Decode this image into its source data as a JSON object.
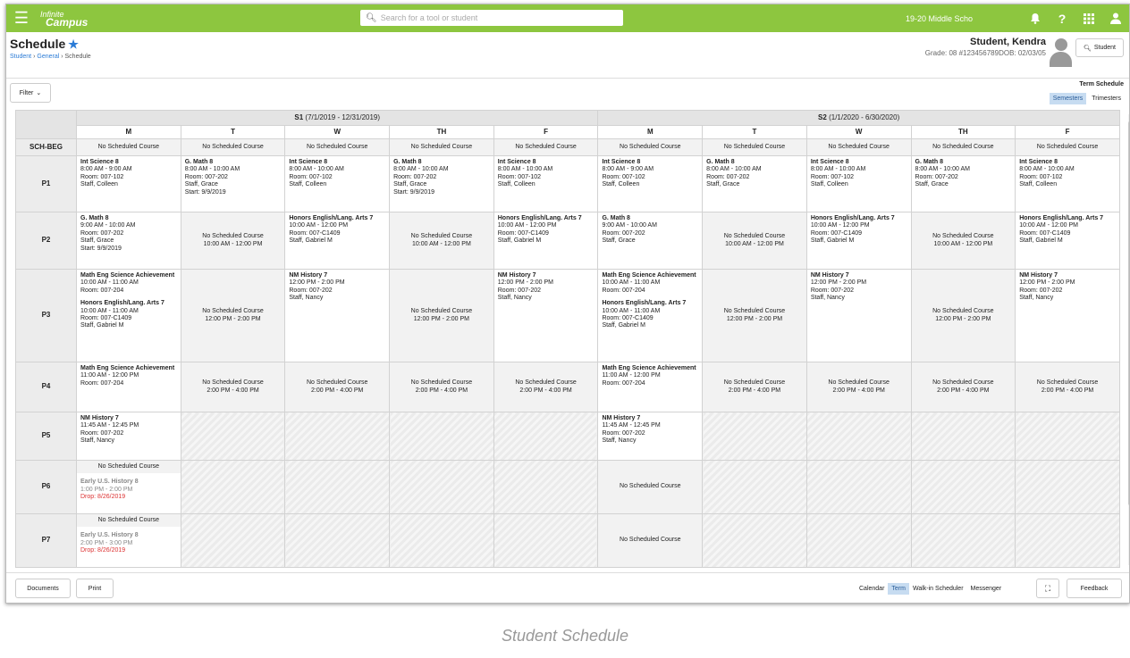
{
  "app": {
    "logo_line1": "Infinite",
    "logo_line2": "Campus",
    "search_placeholder": "Search for a tool or student",
    "school": "19-20 Middle Scho"
  },
  "header": {
    "title": "Schedule",
    "breadcrumb": [
      "Student",
      "General",
      "Schedule"
    ],
    "student_name": "Student, Kendra",
    "student_info": "Grade: 08 #123456789DOB: 02/03/05",
    "student_button": "Student"
  },
  "toolbar": {
    "filter": "Filter",
    "term_schedule_label": "Term Schedule",
    "term_options": [
      "Semesters",
      "Trimesters"
    ],
    "selected_term_option": "Semesters"
  },
  "schedule": {
    "semesters": [
      {
        "name": "S1",
        "dates": "(7/1/2019 - 12/31/2019)"
      },
      {
        "name": "S2",
        "dates": "(1/1/2020 - 6/30/2020)"
      }
    ],
    "days": [
      "M",
      "T",
      "W",
      "TH",
      "F",
      "M",
      "T",
      "W",
      "TH",
      "F"
    ],
    "periods": [
      {
        "label": "SCH-BEG",
        "cells": [
          {
            "type": "nsc",
            "text": "No Scheduled Course"
          },
          {
            "type": "nsc",
            "text": "No Scheduled Course"
          },
          {
            "type": "nsc",
            "text": "No Scheduled Course"
          },
          {
            "type": "nsc",
            "text": "No Scheduled Course"
          },
          {
            "type": "nsc",
            "text": "No Scheduled Course"
          },
          {
            "type": "nsc",
            "text": "No Scheduled Course"
          },
          {
            "type": "nsc",
            "text": "No Scheduled Course"
          },
          {
            "type": "nsc",
            "text": "No Scheduled Course"
          },
          {
            "type": "nsc",
            "text": "No Scheduled Course"
          },
          {
            "type": "nsc",
            "text": "No Scheduled Course"
          }
        ]
      },
      {
        "label": "P1",
        "cells": [
          {
            "type": "course",
            "courses": [
              {
                "name": "Int Science 8",
                "lines": [
                  "8:00 AM - 9:00 AM",
                  "Room: 007-102",
                  "Staff, Colleen"
                ]
              }
            ]
          },
          {
            "type": "course",
            "courses": [
              {
                "name": "G. Math 8",
                "lines": [
                  "8:00 AM - 10:00 AM",
                  "Room: 007-202",
                  "Staff, Grace",
                  "Start: 9/9/2019"
                ]
              }
            ]
          },
          {
            "type": "course",
            "courses": [
              {
                "name": "Int Science 8",
                "lines": [
                  "8:00 AM - 10:00 AM",
                  "Room: 007-102",
                  "Staff, Colleen"
                ]
              }
            ]
          },
          {
            "type": "course",
            "courses": [
              {
                "name": "G. Math 8",
                "lines": [
                  "8:00 AM - 10:00 AM",
                  "Room: 007-202",
                  "Staff, Grace",
                  "Start: 9/9/2019"
                ]
              }
            ]
          },
          {
            "type": "course",
            "courses": [
              {
                "name": "Int Science 8",
                "lines": [
                  "8:00 AM - 10:00 AM",
                  "Room: 007-102",
                  "Staff, Colleen"
                ]
              }
            ]
          },
          {
            "type": "course",
            "courses": [
              {
                "name": "Int Science 8",
                "lines": [
                  "8:00 AM - 9:00 AM",
                  "Room: 007-102",
                  "Staff, Colleen"
                ]
              }
            ]
          },
          {
            "type": "course",
            "courses": [
              {
                "name": "G. Math 8",
                "lines": [
                  "8:00 AM - 10:00 AM",
                  "Room: 007-202",
                  "Staff, Grace"
                ]
              }
            ]
          },
          {
            "type": "course",
            "courses": [
              {
                "name": "Int Science 8",
                "lines": [
                  "8:00 AM - 10:00 AM",
                  "Room: 007-102",
                  "Staff, Colleen"
                ]
              }
            ]
          },
          {
            "type": "course",
            "courses": [
              {
                "name": "G. Math 8",
                "lines": [
                  "8:00 AM - 10:00 AM",
                  "Room: 007-202",
                  "Staff, Grace"
                ]
              }
            ]
          },
          {
            "type": "course",
            "courses": [
              {
                "name": "Int Science 8",
                "lines": [
                  "8:00 AM - 10:00 AM",
                  "Room: 007-102",
                  "Staff, Colleen"
                ]
              }
            ]
          }
        ]
      },
      {
        "label": "P2",
        "cells": [
          {
            "type": "course",
            "courses": [
              {
                "name": "G. Math 8",
                "lines": [
                  "9:00 AM - 10:00 AM",
                  "Room: 007-202",
                  "Staff, Grace",
                  "Start: 9/9/2019"
                ]
              }
            ]
          },
          {
            "type": "nsc",
            "text": "No Scheduled Course",
            "time": "10:00 AM - 12:00 PM"
          },
          {
            "type": "course",
            "courses": [
              {
                "name": "Honors English/Lang. Arts 7",
                "lines": [
                  "10:00 AM - 12:00 PM",
                  "Room: 007-C1409",
                  "Staff, Gabriel M"
                ]
              }
            ]
          },
          {
            "type": "nsc",
            "text": "No Scheduled Course",
            "time": "10:00 AM - 12:00 PM"
          },
          {
            "type": "course",
            "courses": [
              {
                "name": "Honors English/Lang. Arts 7",
                "lines": [
                  "10:00 AM - 12:00 PM",
                  "Room: 007-C1409",
                  "Staff, Gabriel M"
                ]
              }
            ]
          },
          {
            "type": "course",
            "courses": [
              {
                "name": "G. Math 8",
                "lines": [
                  "9:00 AM - 10:00 AM",
                  "Room: 007-202",
                  "Staff, Grace"
                ]
              }
            ]
          },
          {
            "type": "nsc",
            "text": "No Scheduled Course",
            "time": "10:00 AM - 12:00 PM"
          },
          {
            "type": "course",
            "courses": [
              {
                "name": "Honors English/Lang. Arts 7",
                "lines": [
                  "10:00 AM - 12:00 PM",
                  "Room: 007-C1409",
                  "Staff, Gabriel M"
                ]
              }
            ]
          },
          {
            "type": "nsc",
            "text": "No Scheduled Course",
            "time": "10:00 AM - 12:00 PM"
          },
          {
            "type": "course",
            "courses": [
              {
                "name": "Honors English/Lang. Arts 7",
                "lines": [
                  "10:00 AM - 12:00 PM",
                  "Room: 007-C1409",
                  "Staff, Gabriel M"
                ]
              }
            ]
          }
        ]
      },
      {
        "label": "P3",
        "cells": [
          {
            "type": "course",
            "courses": [
              {
                "name": "Math Eng Science Achievement",
                "lines": [
                  "10:00 AM - 11:00 AM",
                  "Room: 007-204"
                ]
              },
              {
                "name": "Honors English/Lang. Arts 7",
                "lines": [
                  "10:00 AM - 11:00 AM",
                  "Room: 007-C1409",
                  "Staff, Gabriel M"
                ]
              }
            ]
          },
          {
            "type": "nsc",
            "text": "No Scheduled Course",
            "time": "12:00 PM - 2:00 PM"
          },
          {
            "type": "course",
            "courses": [
              {
                "name": "NM History 7",
                "lines": [
                  "12:00 PM - 2:00 PM",
                  "Room: 007-202",
                  "Staff, Nancy"
                ]
              }
            ]
          },
          {
            "type": "nsc",
            "text": "No Scheduled Course",
            "time": "12:00 PM - 2:00 PM"
          },
          {
            "type": "course",
            "courses": [
              {
                "name": "NM History 7",
                "lines": [
                  "12:00 PM - 2:00 PM",
                  "Room: 007-202",
                  "Staff, Nancy"
                ]
              }
            ]
          },
          {
            "type": "course",
            "courses": [
              {
                "name": "Math Eng Science Achievement",
                "lines": [
                  "10:00 AM - 11:00 AM",
                  "Room: 007-204"
                ]
              },
              {
                "name": "Honors English/Lang. Arts 7",
                "lines": [
                  "10:00 AM - 11:00 AM",
                  "Room: 007-C1409",
                  "Staff, Gabriel M"
                ]
              }
            ]
          },
          {
            "type": "nsc",
            "text": "No Scheduled Course",
            "time": "12:00 PM - 2:00 PM"
          },
          {
            "type": "course",
            "courses": [
              {
                "name": "NM History 7",
                "lines": [
                  "12:00 PM - 2:00 PM",
                  "Room: 007-202",
                  "Staff, Nancy"
                ]
              }
            ]
          },
          {
            "type": "nsc",
            "text": "No Scheduled Course",
            "time": "12:00 PM - 2:00 PM"
          },
          {
            "type": "course",
            "courses": [
              {
                "name": "NM History 7",
                "lines": [
                  "12:00 PM - 2:00 PM",
                  "Room: 007-202",
                  "Staff, Nancy"
                ]
              }
            ]
          }
        ]
      },
      {
        "label": "P4",
        "cells": [
          {
            "type": "course",
            "courses": [
              {
                "name": "Math Eng Science Achievement",
                "lines": [
                  "11:00 AM - 12:00 PM",
                  "Room: 007-204"
                ]
              }
            ]
          },
          {
            "type": "nsc",
            "text": "No Scheduled Course",
            "time": "2:00 PM - 4:00 PM"
          },
          {
            "type": "nsc",
            "text": "No Scheduled Course",
            "time": "2:00 PM - 4:00 PM"
          },
          {
            "type": "nsc",
            "text": "No Scheduled Course",
            "time": "2:00 PM - 4:00 PM"
          },
          {
            "type": "nsc",
            "text": "No Scheduled Course",
            "time": "2:00 PM - 4:00 PM"
          },
          {
            "type": "course",
            "courses": [
              {
                "name": "Math Eng Science Achievement",
                "lines": [
                  "11:00 AM - 12:00 PM",
                  "Room: 007-204"
                ]
              }
            ]
          },
          {
            "type": "nsc",
            "text": "No Scheduled Course",
            "time": "2:00 PM - 4:00 PM"
          },
          {
            "type": "nsc",
            "text": "No Scheduled Course",
            "time": "2:00 PM - 4:00 PM"
          },
          {
            "type": "nsc",
            "text": "No Scheduled Course",
            "time": "2:00 PM - 4:00 PM"
          },
          {
            "type": "nsc",
            "text": "No Scheduled Course",
            "time": "2:00 PM - 4:00 PM"
          }
        ]
      },
      {
        "label": "P5",
        "cells": [
          {
            "type": "course",
            "courses": [
              {
                "name": "NM History 7",
                "lines": [
                  "11:45 AM - 12:45 PM",
                  "Room: 007-202",
                  "Staff, Nancy"
                ]
              }
            ]
          },
          {
            "type": "blank"
          },
          {
            "type": "blank"
          },
          {
            "type": "blank"
          },
          {
            "type": "blank"
          },
          {
            "type": "course",
            "courses": [
              {
                "name": "NM History 7",
                "lines": [
                  "11:45 AM - 12:45 PM",
                  "Room: 007-202",
                  "Staff, Nancy"
                ]
              }
            ]
          },
          {
            "type": "blank"
          },
          {
            "type": "blank"
          },
          {
            "type": "blank"
          },
          {
            "type": "blank"
          }
        ]
      },
      {
        "label": "P6",
        "cells": [
          {
            "type": "dropped",
            "text": "No Scheduled Course",
            "name": "Early U.S. History 8",
            "time": "1:00 PM - 2:00 PM",
            "drop": "Drop: 8/26/2019"
          },
          {
            "type": "blank"
          },
          {
            "type": "blank"
          },
          {
            "type": "blank"
          },
          {
            "type": "blank"
          },
          {
            "type": "nsc",
            "text": "No Scheduled Course"
          },
          {
            "type": "blank"
          },
          {
            "type": "blank"
          },
          {
            "type": "blank"
          },
          {
            "type": "blank"
          }
        ]
      },
      {
        "label": "P7",
        "cells": [
          {
            "type": "dropped",
            "text": "No Scheduled Course",
            "name": "Early U.S. History 8",
            "time": "2:00 PM - 3:00 PM",
            "drop": "Drop: 8/26/2019"
          },
          {
            "type": "blank"
          },
          {
            "type": "blank"
          },
          {
            "type": "blank"
          },
          {
            "type": "blank"
          },
          {
            "type": "nsc",
            "text": "No Scheduled Course"
          },
          {
            "type": "blank"
          },
          {
            "type": "blank"
          },
          {
            "type": "blank"
          },
          {
            "type": "blank"
          }
        ]
      }
    ]
  },
  "footer": {
    "documents": "Documents",
    "print": "Print",
    "view_tabs": [
      "Calendar",
      "Term",
      "Walk-in Scheduler",
      "Messenger"
    ],
    "selected_view": "Term",
    "feedback": "Feedback"
  },
  "caption": "Student Schedule",
  "colors": {
    "topbar": "#8dc63f",
    "link": "#2a7bd6",
    "drop": "#d33333",
    "selected_tab": "#c7dcf1"
  }
}
